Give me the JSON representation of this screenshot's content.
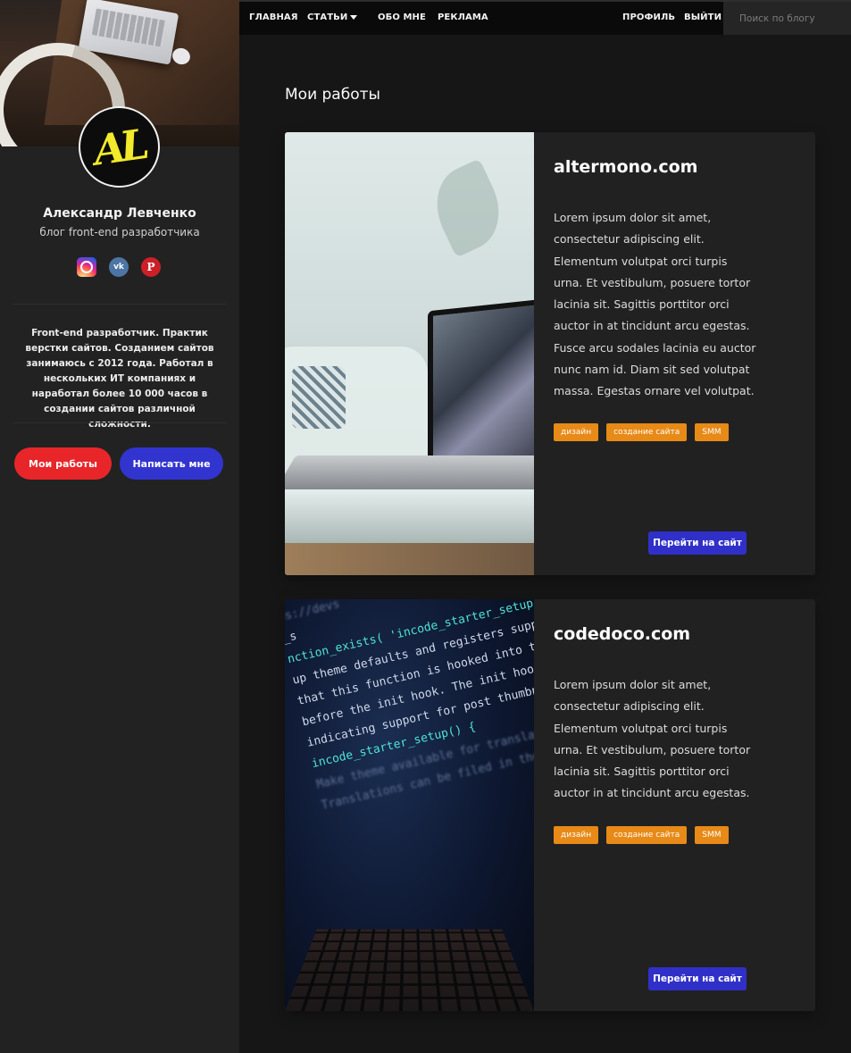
{
  "nav": {
    "items": [
      {
        "label": "ГЛАВНАЯ"
      },
      {
        "label": "СТАТЬИ"
      },
      {
        "label": "ОБО МНЕ"
      },
      {
        "label": "РЕКЛАМА"
      }
    ],
    "right_items": [
      {
        "label": "ПРОФИЛЬ"
      },
      {
        "label": "ВЫЙТИ"
      }
    ],
    "search_placeholder": "Поиск по блогу",
    "dropdown_icon": "caret-down-icon"
  },
  "sidebar": {
    "avatar_text": "AL",
    "name": "Александр Левченко",
    "subtitle": "блог front-end разработчика",
    "socials": [
      {
        "name": "instagram-icon"
      },
      {
        "name": "vk-icon",
        "glyph": "vk"
      },
      {
        "name": "pinterest-icon",
        "glyph": "P"
      }
    ],
    "about": "Front-end разработчик. Практик верстки сайтов. Созданием сайтов занимаюсь с 2012 года. Работал в нескольких ИТ компаниях и наработал более 10 000 часов в создании сайтов различной сложности.",
    "buttons": {
      "works": "Мои работы",
      "write": "Написать мне"
    }
  },
  "main": {
    "title": "Мои работы",
    "cards": [
      {
        "title": "altermono.com",
        "text": "Lorem ipsum dolor sit amet, consectetur adipiscing elit. Elementum volutpat orci turpis urna. Et vestibulum, posuere tortor lacinia sit. Sagittis porttitor orci auctor in at tincidunt arcu egestas. Fusce arcu sodales lacinia eu auctor nunc nam id. Diam sit sed volutpat massa. Egestas ornare vel volutpat.",
        "tags": [
          "дизайн",
          "создание сайта",
          "SMM"
        ],
        "button": "Перейти на сайт"
      },
      {
        "title": "codedoco.com",
        "text": "Lorem ipsum dolor sit amet, consectetur adipiscing elit. Elementum volutpat orci turpis urna. Et vestibulum, posuere tortor lacinia sit. Sagittis porttitor orci auctor in at tincidunt arcu egestas.",
        "tags": [
          "дизайн",
          "создание сайта",
          "SMM"
        ],
        "button": "Перейти на сайт",
        "code_lines": [
          "ps://devs",
          "_s",
          "nction_exists( 'incode_starter_setup",
          "up theme defaults and registers suppo",
          "that this function is hooked into the",
          "before the init hook. The init hook is",
          "indicating support for post thumbnails.",
          "incode_starter_setup() {",
          "Make theme available for translation.",
          "Translations can be filed in the /langua"
        ]
      }
    ]
  },
  "colors": {
    "background": "#161616",
    "sidebar": "#222222",
    "accent_red": "#e8262a",
    "accent_blue": "#3234cf",
    "tag_orange": "#e78a17",
    "avatar_yellow": "#f2ea2a"
  }
}
